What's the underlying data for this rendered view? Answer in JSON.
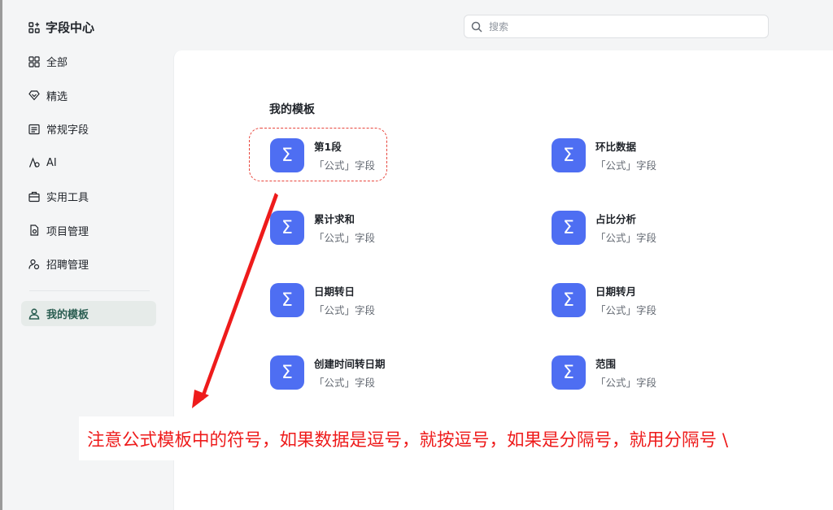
{
  "header": {
    "app_title": "字段中心",
    "app_icon": "grid-settings-icon",
    "search": {
      "placeholder": "搜索",
      "value": ""
    }
  },
  "sidebar": {
    "items": [
      {
        "id": "all",
        "label": "全部",
        "icon": "grid-icon",
        "active": false
      },
      {
        "id": "featured",
        "label": "精选",
        "icon": "diamond-icon",
        "active": false
      },
      {
        "id": "regular",
        "label": "常规字段",
        "icon": "list-icon",
        "active": false
      },
      {
        "id": "ai",
        "label": "AI",
        "icon": "ai-icon",
        "active": false
      },
      {
        "id": "tools",
        "label": "实用工具",
        "icon": "toolbox-icon",
        "active": false
      },
      {
        "id": "project",
        "label": "项目管理",
        "icon": "project-file-icon",
        "active": false
      },
      {
        "id": "recruit",
        "label": "招聘管理",
        "icon": "people-icon",
        "active": false
      },
      {
        "id": "my-templates",
        "label": "我的模板",
        "icon": "user-icon",
        "active": true
      }
    ]
  },
  "main": {
    "section_title": "我的模板",
    "templates": [
      {
        "name": "第1段",
        "type": "「公式」字段",
        "icon": "sigma-icon"
      },
      {
        "name": "环比数据",
        "type": "「公式」字段",
        "icon": "sigma-icon"
      },
      {
        "name": "累计求和",
        "type": "「公式」字段",
        "icon": "sigma-icon"
      },
      {
        "name": "占比分析",
        "type": "「公式」字段",
        "icon": "sigma-icon"
      },
      {
        "name": "日期转日",
        "type": "「公式」字段",
        "icon": "sigma-icon"
      },
      {
        "name": "日期转月",
        "type": "「公式」字段",
        "icon": "sigma-icon"
      },
      {
        "name": "创建时间转日期",
        "type": "「公式」字段",
        "icon": "sigma-icon"
      },
      {
        "name": "范围",
        "type": "「公式」字段",
        "icon": "sigma-icon"
      }
    ]
  },
  "annotation": {
    "text": "注意公式模板中的符号，如果数据是逗号，就按逗号，如果是分隔号，就用分隔号 \\",
    "color": "#ee1b1b"
  },
  "colors": {
    "accent": "#4e6ef2",
    "active_nav_bg": "#e6ebe9",
    "active_nav_text": "#2b5e52"
  }
}
